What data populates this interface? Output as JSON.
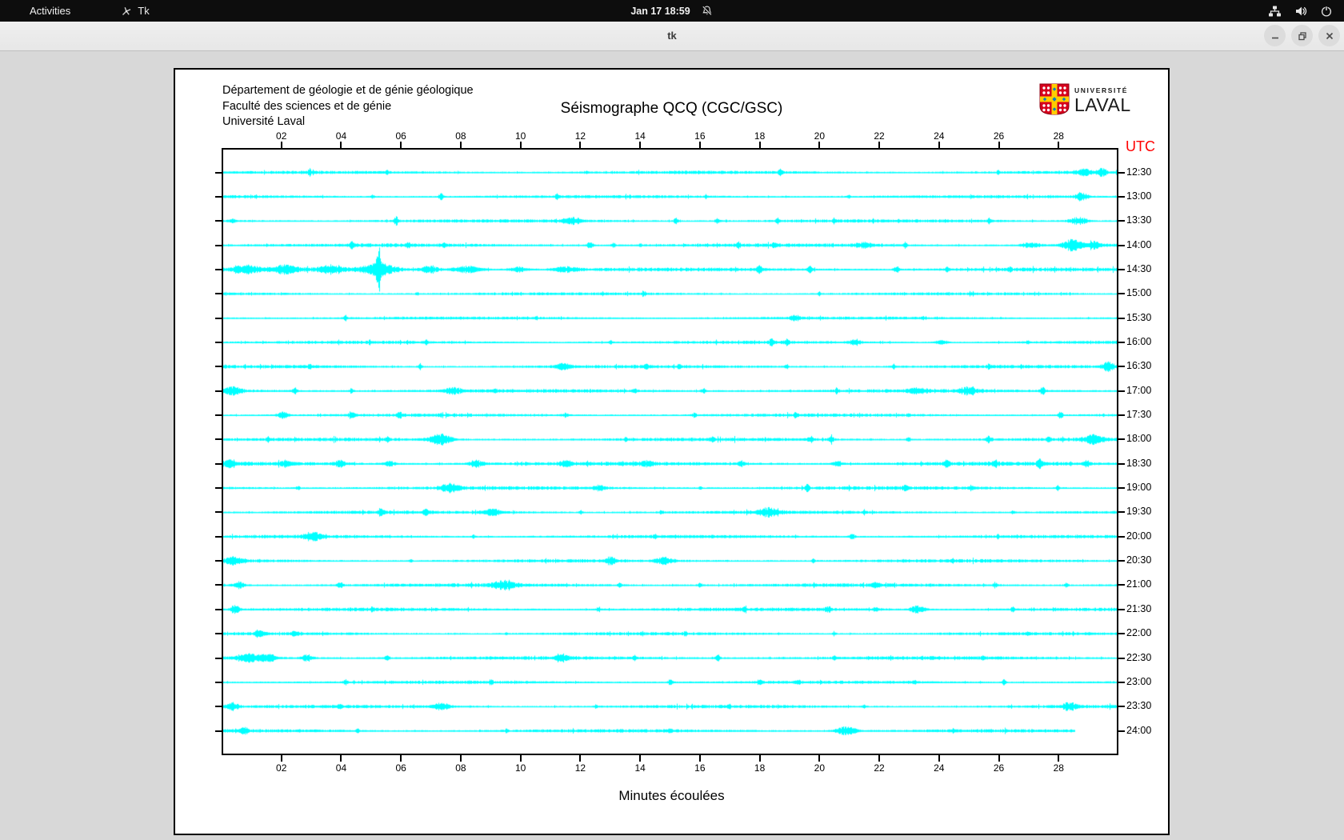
{
  "topbar": {
    "activities_label": "Activities",
    "app_label": "Tk",
    "clock": "Jan 17 18:59"
  },
  "titlebar": {
    "title": "tk"
  },
  "document": {
    "header_lines": [
      "Département de géologie et de génie géologique",
      "Faculté des sciences et de génie",
      "Université Laval"
    ],
    "title": "Séismographe QCQ (CGC/GSC)",
    "logo": {
      "top": "UNIVERSITÉ",
      "bottom": "LAVAL"
    },
    "utc_label": "UTC",
    "xlabel": "Minutes écoulées"
  },
  "colors": {
    "trace": "#00ffff",
    "utc_label": "#ff0000",
    "topbar_bg": "#0d0d0d",
    "titlebar_bg": "#ebebeb",
    "desktop_bg": "#d8d8d8",
    "laval_red": "#d6001c",
    "laval_yellow": "#ffcd00",
    "laval_blue": "#0082c3"
  },
  "chart_data": {
    "type": "line",
    "subtype": "helicorder-seismogram",
    "title": "Séismographe QCQ (CGC/GSC)",
    "xlabel": "Minutes écoulées",
    "right_axis_label": "UTC",
    "x_range": [
      0,
      30
    ],
    "x_tick_minutes": [
      2,
      4,
      6,
      8,
      10,
      12,
      14,
      16,
      18,
      20,
      22,
      24,
      26,
      28
    ],
    "x_tick_labels": [
      "02",
      "04",
      "06",
      "08",
      "10",
      "12",
      "14",
      "16",
      "18",
      "20",
      "22",
      "24",
      "26",
      "28"
    ],
    "rows": [
      {
        "utc": "12:30",
        "base": 1.3,
        "end": 30,
        "events": [
          [
            2.9,
            4,
            0.06
          ],
          [
            5.5,
            3,
            0.05
          ],
          [
            12.2,
            2.5,
            0.05
          ],
          [
            18.7,
            5,
            0.07
          ],
          [
            26,
            2.5,
            0.05
          ],
          [
            28.9,
            4,
            0.25
          ],
          [
            29.5,
            5,
            0.15
          ]
        ]
      },
      {
        "utc": "13:00",
        "base": 1.3,
        "end": 30,
        "events": [
          [
            5,
            2.5,
            0.05
          ],
          [
            7.3,
            5,
            0.07
          ],
          [
            11.2,
            3,
            0.06
          ],
          [
            16.2,
            2.5,
            0.05
          ],
          [
            21,
            2.5,
            0.05
          ],
          [
            28.8,
            5,
            0.2
          ]
        ]
      },
      {
        "utc": "13:30",
        "base": 1.4,
        "end": 30,
        "events": [
          [
            0.3,
            3,
            0.1
          ],
          [
            5.8,
            5,
            0.07
          ],
          [
            11.7,
            4,
            0.3
          ],
          [
            15.2,
            4,
            0.07
          ],
          [
            16.6,
            4,
            0.07
          ],
          [
            18.6,
            3.5,
            0.06
          ],
          [
            20.5,
            3,
            0.05
          ],
          [
            25.7,
            3.5,
            0.06
          ],
          [
            28.7,
            5,
            0.3
          ]
        ]
      },
      {
        "utc": "14:00",
        "base": 1.5,
        "end": 30,
        "events": [
          [
            4.3,
            4,
            0.07
          ],
          [
            6.2,
            3.5,
            0.06
          ],
          [
            7.4,
            3.5,
            0.06
          ],
          [
            12.3,
            4.5,
            0.1
          ],
          [
            13.1,
            3.5,
            0.06
          ],
          [
            14,
            3,
            0.05
          ],
          [
            17.3,
            4,
            0.06
          ],
          [
            18.5,
            3.5,
            0.06
          ],
          [
            21.5,
            3,
            0.3
          ],
          [
            22.9,
            3.5,
            0.06
          ],
          [
            27.1,
            3.5,
            0.3
          ],
          [
            28.5,
            7,
            0.35
          ],
          [
            29.2,
            5,
            0.2
          ]
        ]
      },
      {
        "utc": "14:30",
        "base": 1.6,
        "end": 30,
        "events": [
          [
            0.8,
            4,
            0.5
          ],
          [
            2.1,
            5,
            0.4
          ],
          [
            3.6,
            5,
            0.4
          ],
          [
            5.2,
            28,
            0.07
          ],
          [
            5.2,
            7,
            0.6
          ],
          [
            6.9,
            5,
            0.3
          ],
          [
            8.2,
            4,
            0.5
          ],
          [
            9.9,
            3,
            0.3
          ],
          [
            11.5,
            3,
            0.4
          ],
          [
            18,
            4,
            0.1
          ],
          [
            19.7,
            4.5,
            0.1
          ],
          [
            22.6,
            4,
            0.1
          ],
          [
            24.3,
            3,
            0.08
          ],
          [
            26.4,
            2.5,
            0.06
          ]
        ]
      },
      {
        "utc": "15:00",
        "base": 1.2,
        "end": 30,
        "events": [
          [
            6.5,
            2,
            0.05
          ],
          [
            14.1,
            3.5,
            0.06
          ],
          [
            20,
            2,
            0.05
          ]
        ]
      },
      {
        "utc": "15:30",
        "base": 1.2,
        "end": 30,
        "events": [
          [
            4.1,
            3.5,
            0.06
          ],
          [
            10.5,
            2,
            0.05
          ],
          [
            19.2,
            4,
            0.15
          ],
          [
            23.5,
            2,
            0.05
          ]
        ]
      },
      {
        "utc": "16:00",
        "base": 1.3,
        "end": 30,
        "events": [
          [
            6.8,
            2.5,
            0.05
          ],
          [
            13,
            2.5,
            0.05
          ],
          [
            18.4,
            4.5,
            0.08
          ],
          [
            18.9,
            4,
            0.07
          ],
          [
            21.2,
            3,
            0.2
          ],
          [
            24.1,
            3,
            0.2
          ],
          [
            27,
            2.5,
            0.05
          ]
        ]
      },
      {
        "utc": "16:30",
        "base": 1.4,
        "end": 30,
        "events": [
          [
            2.9,
            3.5,
            0.06
          ],
          [
            6.6,
            3,
            0.06
          ],
          [
            11.4,
            4,
            0.25
          ],
          [
            14.2,
            3,
            0.06
          ],
          [
            15.3,
            3.5,
            0.06
          ],
          [
            18.9,
            3,
            0.06
          ],
          [
            22.5,
            3.5,
            0.06
          ],
          [
            25.7,
            3,
            0.05
          ],
          [
            29.7,
            6,
            0.2
          ]
        ]
      },
      {
        "utc": "17:00",
        "base": 1.5,
        "end": 30,
        "events": [
          [
            0.3,
            5,
            0.3
          ],
          [
            2.4,
            4,
            0.08
          ],
          [
            4.3,
            3.5,
            0.07
          ],
          [
            7.7,
            4,
            0.3
          ],
          [
            9.1,
            3,
            0.06
          ],
          [
            13.8,
            3,
            0.06
          ],
          [
            16.1,
            3.5,
            0.07
          ],
          [
            20.6,
            3,
            0.06
          ],
          [
            23.3,
            3,
            0.3
          ],
          [
            25,
            5,
            0.3
          ],
          [
            27.5,
            4.5,
            0.1
          ]
        ]
      },
      {
        "utc": "17:30",
        "base": 1.4,
        "end": 30,
        "events": [
          [
            2,
            4,
            0.2
          ],
          [
            4.3,
            4.5,
            0.1
          ],
          [
            5.9,
            4,
            0.08
          ],
          [
            11.5,
            3.5,
            0.07
          ],
          [
            15.8,
            3,
            0.06
          ],
          [
            19.2,
            2.5,
            0.05
          ],
          [
            23,
            2.5,
            0.05
          ],
          [
            28.1,
            4,
            0.08
          ]
        ]
      },
      {
        "utc": "18:00",
        "base": 1.5,
        "end": 30,
        "events": [
          [
            1.5,
            3,
            0.06
          ],
          [
            5.5,
            3.5,
            0.06
          ],
          [
            7.3,
            7,
            0.35
          ],
          [
            13.5,
            3,
            0.06
          ],
          [
            16.4,
            3,
            0.06
          ],
          [
            19.7,
            4,
            0.08
          ],
          [
            20.4,
            4,
            0.08
          ],
          [
            23,
            3,
            0.06
          ],
          [
            25.7,
            4,
            0.1
          ],
          [
            27.7,
            3,
            0.06
          ],
          [
            29.2,
            6,
            0.3
          ]
        ]
      },
      {
        "utc": "18:30",
        "base": 1.7,
        "end": 30,
        "events": [
          [
            0.2,
            5,
            0.15
          ],
          [
            2.1,
            3.5,
            0.2
          ],
          [
            3.9,
            4,
            0.2
          ],
          [
            5.6,
            3,
            0.2
          ],
          [
            8.5,
            4,
            0.25
          ],
          [
            11.5,
            3,
            0.2
          ],
          [
            14.2,
            3,
            0.2
          ],
          [
            17.4,
            4,
            0.1
          ],
          [
            20.6,
            3,
            0.2
          ],
          [
            24.3,
            4,
            0.1
          ],
          [
            25.9,
            4,
            0.1
          ],
          [
            27.4,
            4.5,
            0.1
          ],
          [
            29,
            3.5,
            0.1
          ]
        ]
      },
      {
        "utc": "19:00",
        "base": 1.5,
        "end": 30,
        "events": [
          [
            2.5,
            3,
            0.06
          ],
          [
            7.6,
            5,
            0.3
          ],
          [
            12.6,
            3,
            0.2
          ],
          [
            16,
            2.5,
            0.05
          ],
          [
            19.6,
            4,
            0.08
          ],
          [
            22.9,
            4,
            0.08
          ],
          [
            25.1,
            3.5,
            0.07
          ],
          [
            28,
            3,
            0.06
          ]
        ]
      },
      {
        "utc": "19:30",
        "base": 1.4,
        "end": 30,
        "events": [
          [
            5.3,
            4.5,
            0.1
          ],
          [
            6.8,
            4,
            0.08
          ],
          [
            9,
            4.5,
            0.3
          ],
          [
            12,
            2.5,
            0.05
          ],
          [
            14.7,
            3,
            0.06
          ],
          [
            18.3,
            5,
            0.35
          ],
          [
            21.5,
            2.5,
            0.05
          ],
          [
            26.5,
            2.5,
            0.05
          ]
        ]
      },
      {
        "utc": "20:00",
        "base": 1.4,
        "end": 30,
        "events": [
          [
            3,
            5,
            0.3
          ],
          [
            8.4,
            2.5,
            0.05
          ],
          [
            14.5,
            2.5,
            0.05
          ],
          [
            21.1,
            4,
            0.1
          ],
          [
            26,
            2.5,
            0.05
          ]
        ]
      },
      {
        "utc": "20:30",
        "base": 1.4,
        "end": 30,
        "events": [
          [
            0.4,
            5,
            0.3
          ],
          [
            6.3,
            2.5,
            0.05
          ],
          [
            13,
            4.5,
            0.15
          ],
          [
            14.8,
            4,
            0.3
          ],
          [
            19.8,
            2.5,
            0.05
          ],
          [
            24.5,
            2.5,
            0.06
          ]
        ]
      },
      {
        "utc": "21:00",
        "base": 1.5,
        "end": 30,
        "events": [
          [
            0.5,
            4,
            0.2
          ],
          [
            3.9,
            4,
            0.1
          ],
          [
            9.4,
            5,
            0.4
          ],
          [
            13.3,
            3,
            0.06
          ],
          [
            16,
            3,
            0.06
          ],
          [
            21.9,
            4,
            0.1
          ],
          [
            25.9,
            3.5,
            0.08
          ],
          [
            28.3,
            3,
            0.06
          ]
        ]
      },
      {
        "utc": "21:30",
        "base": 1.5,
        "end": 30,
        "events": [
          [
            0.4,
            6,
            0.15
          ],
          [
            5,
            3,
            0.06
          ],
          [
            12.6,
            3.5,
            0.07
          ],
          [
            17.5,
            3,
            0.06
          ],
          [
            20.3,
            4,
            0.1
          ],
          [
            21.9,
            3.5,
            0.08
          ],
          [
            23.3,
            4.5,
            0.25
          ],
          [
            26.5,
            3,
            0.06
          ]
        ]
      },
      {
        "utc": "22:00",
        "base": 1.3,
        "end": 30,
        "events": [
          [
            1.2,
            4,
            0.15
          ],
          [
            2.4,
            4,
            0.1
          ],
          [
            9.5,
            2,
            0.05
          ],
          [
            15.5,
            2.5,
            0.05
          ],
          [
            20.5,
            2,
            0.05
          ],
          [
            27,
            2,
            0.05
          ]
        ]
      },
      {
        "utc": "22:30",
        "base": 1.5,
        "end": 30,
        "events": [
          [
            0.8,
            5,
            0.4
          ],
          [
            1.5,
            4.5,
            0.3
          ],
          [
            2.8,
            4,
            0.2
          ],
          [
            5.5,
            3,
            0.08
          ],
          [
            11.4,
            4.5,
            0.2
          ],
          [
            13.8,
            3,
            0.06
          ],
          [
            16.6,
            4,
            0.08
          ],
          [
            20.5,
            2.5,
            0.05
          ],
          [
            25.5,
            2.5,
            0.05
          ]
        ]
      },
      {
        "utc": "23:00",
        "base": 1.3,
        "end": 30,
        "events": [
          [
            4.1,
            3.5,
            0.07
          ],
          [
            9,
            2.5,
            0.05
          ],
          [
            15,
            4,
            0.08
          ],
          [
            18,
            4,
            0.08
          ],
          [
            19.3,
            3.5,
            0.07
          ],
          [
            23.2,
            3,
            0.06
          ],
          [
            26.2,
            3.5,
            0.07
          ]
        ]
      },
      {
        "utc": "23:30",
        "base": 1.4,
        "end": 30,
        "events": [
          [
            0.3,
            5,
            0.2
          ],
          [
            3.9,
            3,
            0.06
          ],
          [
            7.3,
            4,
            0.3
          ],
          [
            12.5,
            2.5,
            0.05
          ],
          [
            17,
            2.5,
            0.05
          ],
          [
            21.5,
            2.5,
            0.05
          ],
          [
            28.4,
            4.5,
            0.25
          ]
        ]
      },
      {
        "utc": "24:00",
        "base": 1.4,
        "end": 28.6,
        "events": [
          [
            0.7,
            5,
            0.12
          ],
          [
            4.5,
            2.5,
            0.05
          ],
          [
            9.5,
            2.5,
            0.05
          ],
          [
            15,
            2.5,
            0.05
          ],
          [
            20.9,
            5.5,
            0.35
          ],
          [
            24.5,
            2.5,
            0.06
          ]
        ]
      }
    ]
  }
}
